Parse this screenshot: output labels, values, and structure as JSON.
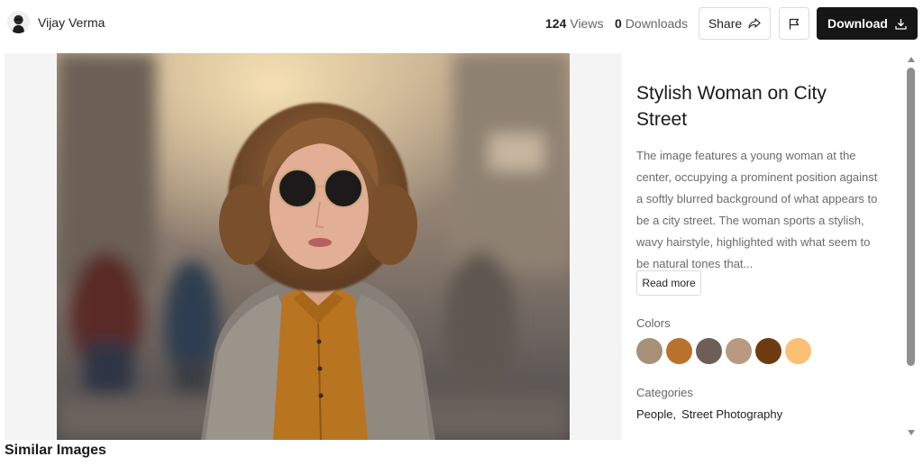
{
  "header": {
    "author_name": "Vijay Verma",
    "views_count": "124",
    "views_label": "Views",
    "downloads_count": "0",
    "downloads_label": "Downloads",
    "share_label": "Share",
    "download_label": "Download"
  },
  "image": {
    "alt": "Stylish Woman on City Street"
  },
  "details": {
    "title": "Stylish Woman on City Street",
    "description": "The image features a young woman at the center, occupying a prominent position against a softly blurred background of what appears to be a city street. The woman sports a stylish, wavy hairstyle, highlighted with what seem to be natural tones that...",
    "read_more_label": "Read more",
    "colors_label": "Colors",
    "colors": [
      "#a89078",
      "#b8722c",
      "#6d5f56",
      "#b99a80",
      "#6e3b11",
      "#fbc074"
    ],
    "categories_label": "Categories",
    "categories": [
      "People,",
      "Street Photography"
    ]
  },
  "sections": {
    "similar_title": "Similar Images"
  },
  "icons": {
    "avatar": "avatar-icon",
    "share": "share-arrow-icon",
    "flag": "flag-icon",
    "download": "download-icon"
  }
}
